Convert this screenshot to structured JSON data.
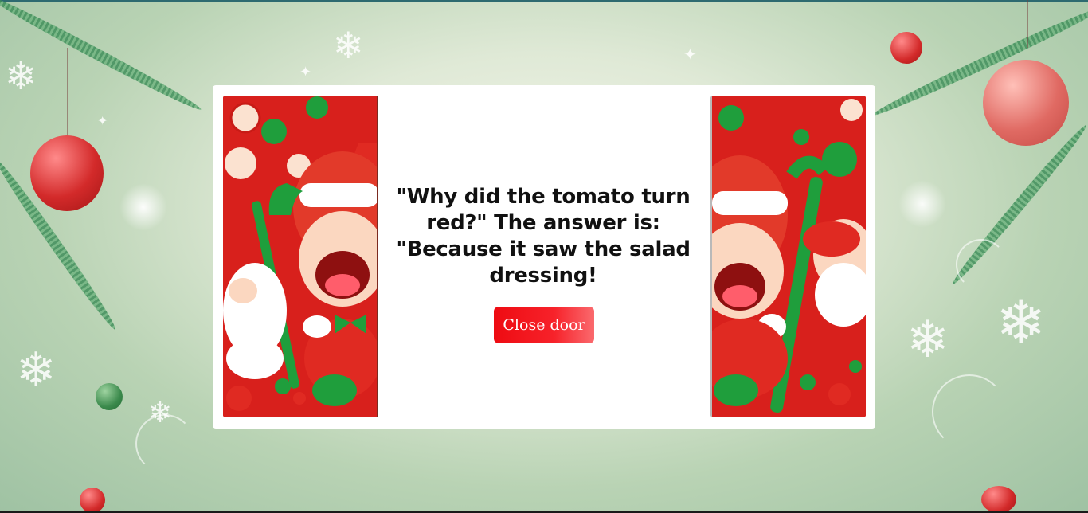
{
  "modal": {
    "joke_text": "\"Why did the tomato turn red?\" The answer is: \"Because it saw the salad dressing!",
    "close_button_label": "Close door"
  },
  "colors": {
    "button_red": "#ee0b12",
    "card_bg": "#ffffff",
    "background_green": "#b9d3b4"
  },
  "icons": {
    "snowflake": "❄",
    "star": "✦"
  }
}
